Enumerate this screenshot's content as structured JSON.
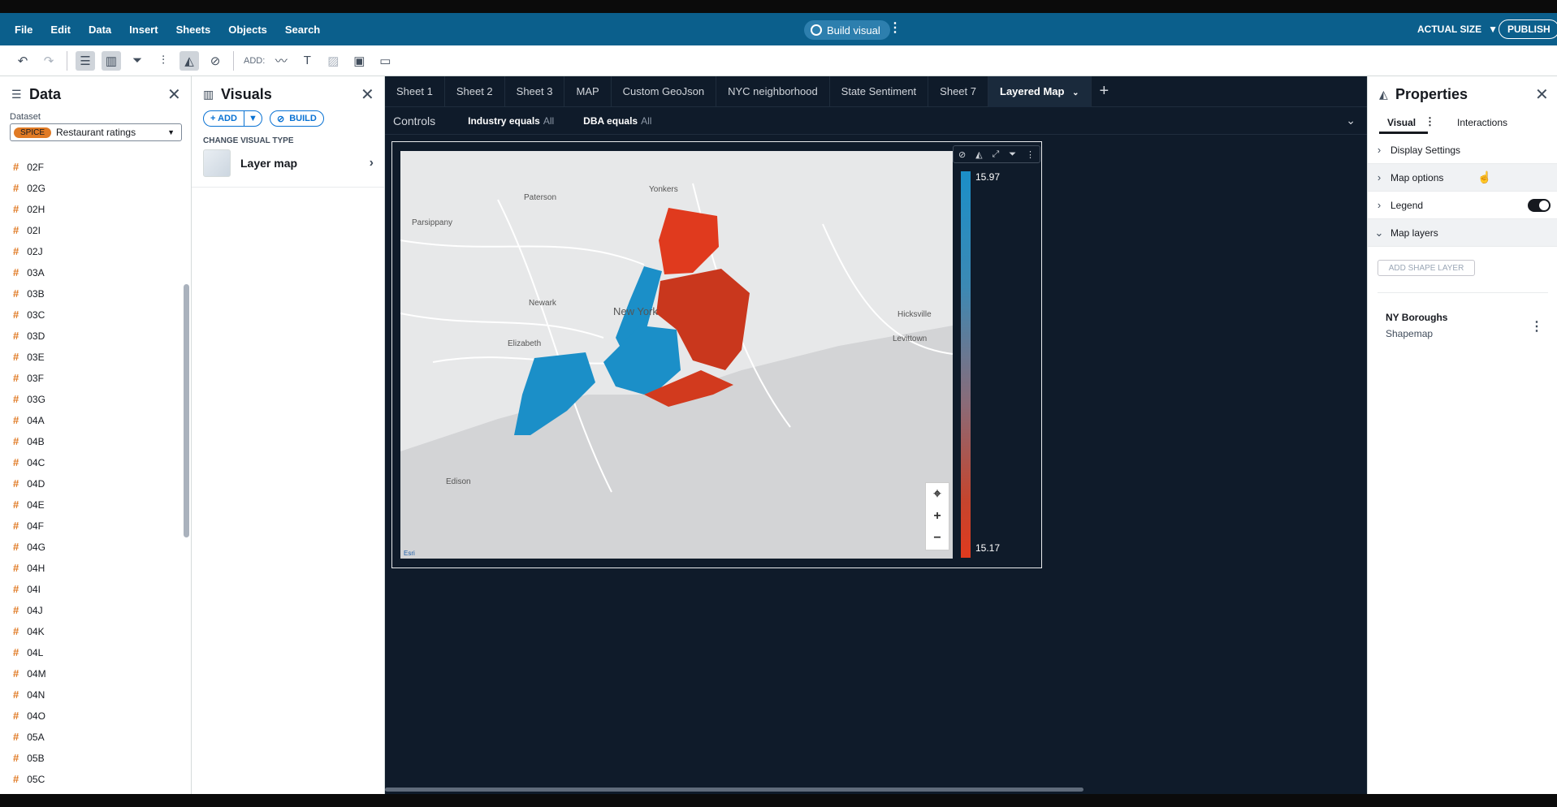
{
  "menubar": {
    "items": [
      "File",
      "Edit",
      "Data",
      "Insert",
      "Sheets",
      "Objects",
      "Search"
    ],
    "build_visual": "Build visual",
    "zoom": "ACTUAL SIZE",
    "publish": "PUBLISH"
  },
  "toolbar": {
    "add_label": "ADD:"
  },
  "data_panel": {
    "title": "Data",
    "dataset_label": "Dataset",
    "spice_badge": "SPICE",
    "dataset_name": "Restaurant ratings",
    "fields": [
      "02F",
      "02G",
      "02H",
      "02I",
      "02J",
      "03A",
      "03B",
      "03C",
      "03D",
      "03E",
      "03F",
      "03G",
      "04A",
      "04B",
      "04C",
      "04D",
      "04E",
      "04F",
      "04G",
      "04H",
      "04I",
      "04J",
      "04K",
      "04L",
      "04M",
      "04N",
      "04O",
      "05A",
      "05B",
      "05C"
    ]
  },
  "visuals_panel": {
    "title": "Visuals",
    "add_label": "+ ADD",
    "build_label": "BUILD",
    "change_type_label": "CHANGE VISUAL TYPE",
    "visual_type": "Layer map"
  },
  "sheets": {
    "tabs": [
      "Sheet 1",
      "Sheet 2",
      "Sheet 3",
      "MAP",
      "Custom GeoJson",
      "NYC neighborhood",
      "State Sentiment",
      "Sheet 7",
      "Layered Map"
    ],
    "active_index": 8
  },
  "controls": {
    "title": "Controls",
    "filters": [
      {
        "label": "Industry equals",
        "value": "All"
      },
      {
        "label": "DBA equals",
        "value": "All"
      }
    ]
  },
  "map": {
    "places": [
      "Yonkers",
      "Paterson",
      "Parsippany",
      "Newark",
      "New York",
      "Elizabeth",
      "Edison",
      "Hicksville",
      "Levittown"
    ],
    "attribution": "Esri",
    "legend_max": "15.97",
    "legend_min": "15.17",
    "colors": {
      "high": "#1b8fc8",
      "low": "#e03a1e"
    }
  },
  "properties_panel": {
    "title": "Properties",
    "tabs": [
      "Visual",
      "Interactions"
    ],
    "sections": [
      "Display Settings",
      "Map options",
      "Legend",
      "Map layers"
    ],
    "legend_on": true,
    "add_shape_layer": "ADD SHAPE LAYER",
    "layer_name": "NY Boroughs",
    "layer_type": "Shapemap"
  }
}
